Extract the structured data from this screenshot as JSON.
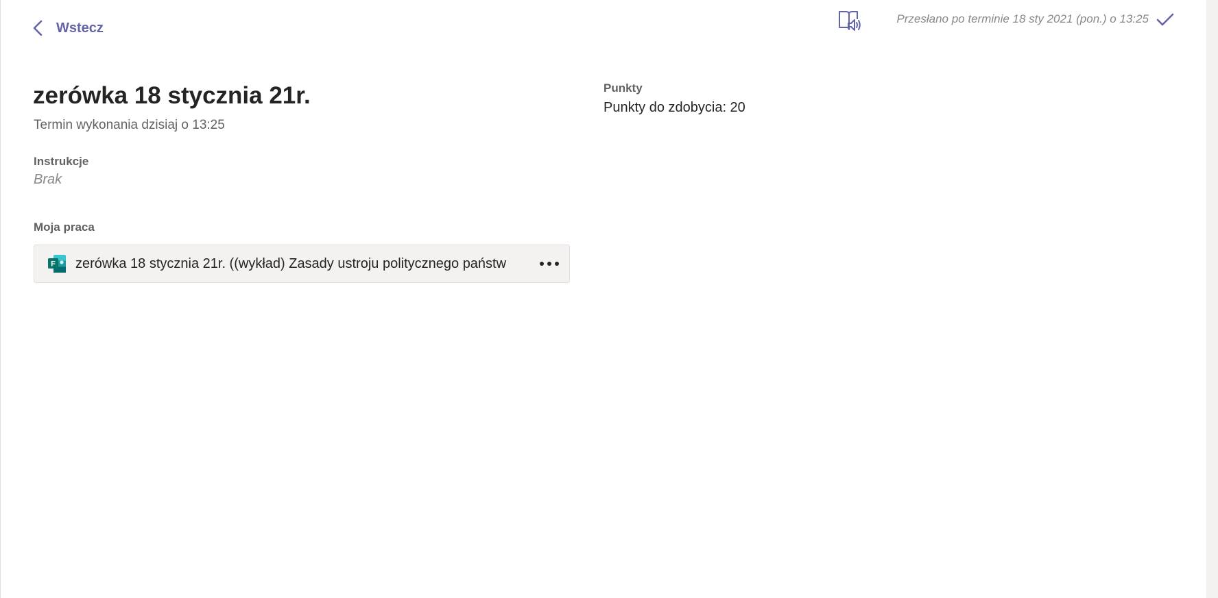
{
  "header": {
    "back_label": "Wstecz",
    "status_text": "Przesłano po terminie 18 sty 2021 (pon.) o 13:25",
    "icons": {
      "back": "chevron-left-icon",
      "reader": "immersive-reader-icon",
      "status": "checkmark-icon"
    }
  },
  "assignment": {
    "title": "zerówka 18 stycznia 21r.",
    "due": "Termin wykonania dzisiaj o 13:25",
    "instructions_label": "Instrukcje",
    "instructions_value": "Brak",
    "my_work_label": "Moja praca",
    "attachment": {
      "name": "zerówka 18 stycznia 21r. ((wykład) Zasady ustroju politycznego państw",
      "icon": "microsoft-forms-icon",
      "more_icon": "more-options-icon"
    }
  },
  "points": {
    "label": "Punkty",
    "value": "Punkty do zdobycia: 20"
  },
  "colors": {
    "accent": "#6264a7",
    "forms_teal": "#036c70",
    "text": "#252423",
    "muted": "#616161",
    "attachment_bg": "#f3f2f1"
  }
}
